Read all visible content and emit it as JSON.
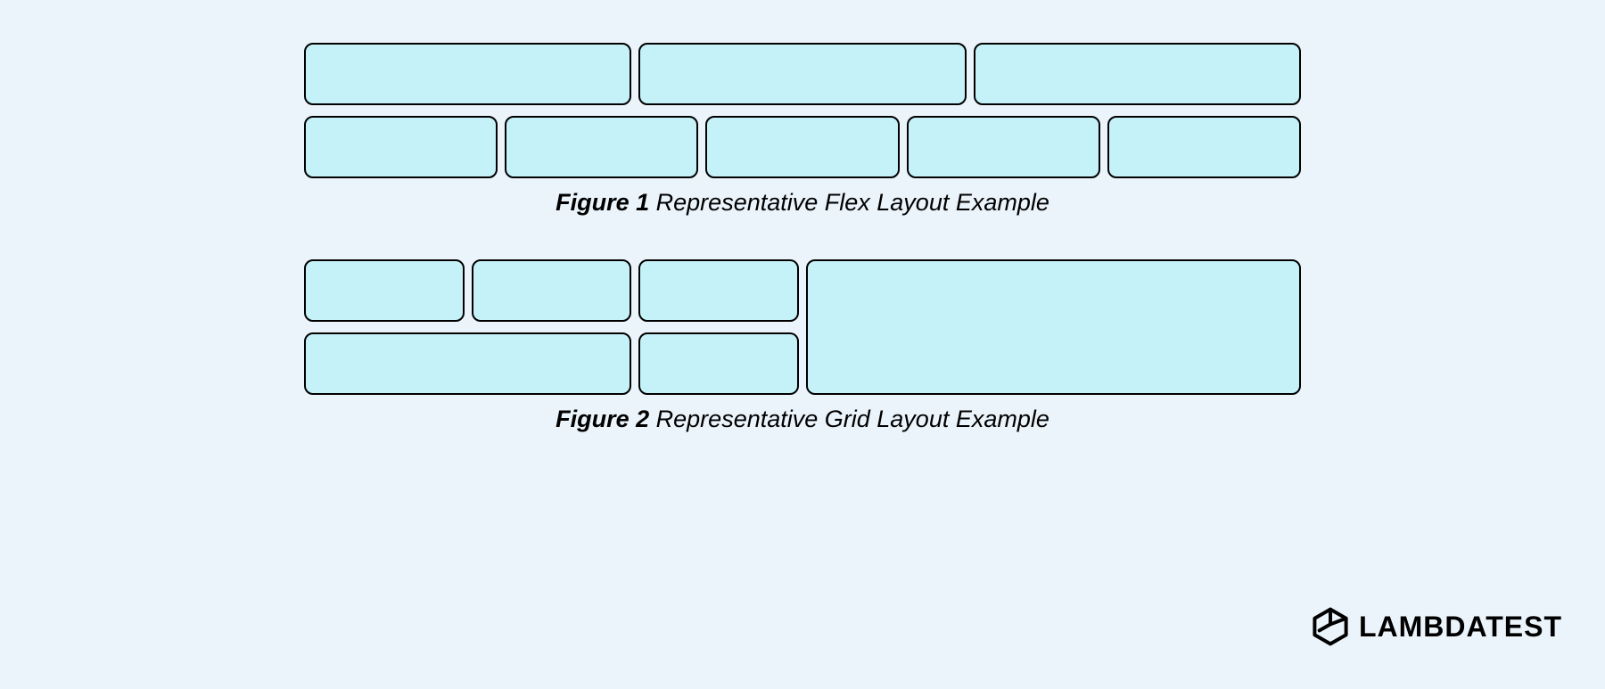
{
  "figure1": {
    "label": "Figure 1",
    "caption": "Representative Flex Layout Example",
    "row1_boxes": 3,
    "row2_boxes": 5
  },
  "figure2": {
    "label": "Figure 2",
    "caption": "Representative Grid Layout Example"
  },
  "brand": {
    "name": "LAMBDATEST"
  },
  "colors": {
    "background": "#ebf4fb",
    "box_fill": "#c5f2f8",
    "box_border": "#000000"
  }
}
